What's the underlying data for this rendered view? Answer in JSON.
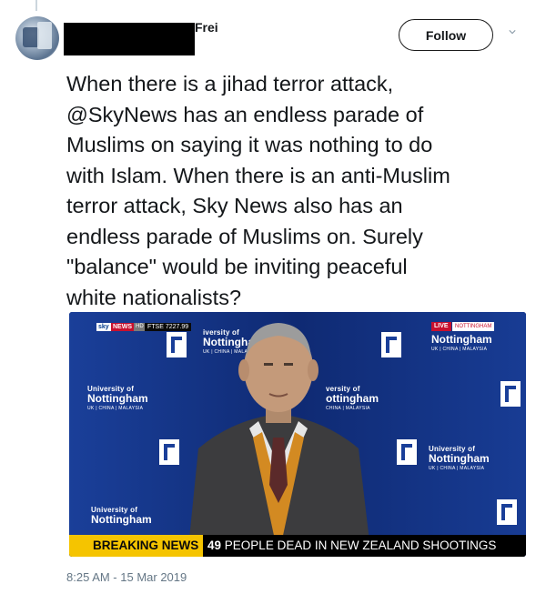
{
  "tweet": {
    "author_name": "Frei",
    "follow_label": "Follow",
    "text_lines": [
      "When there is a jihad terror attack,",
      "@SkyNews has an endless parade of",
      "Muslims on saying it was nothing to do",
      "with Islam. When there is an anti-Muslim",
      "terror attack, Sky News also has an",
      "endless parade of Muslims on. Surely",
      "\"balance\" would be inviting peaceful",
      "white nationalists?"
    ],
    "timestamp": "8:25 AM - 15 Mar 2019"
  },
  "media": {
    "channel_logo": "sky",
    "channel_name": "NEWS",
    "hd_badge": "HD",
    "ticker": "FTSE 7227.99",
    "live_badge": "LIVE",
    "live_location": "NOTTINGHAM",
    "backdrop": {
      "tile_univ": "University of",
      "tile_name": "Nottingham",
      "tile_sub": "UK | CHINA | MALAYSIA",
      "tile_univ_cut": "iversity of",
      "tile_name_cut": "Nottingha",
      "tile_sub_cut": "UK | CHINA | MALA",
      "tile_univ_cut2": "versity of",
      "tile_name_cut2": "ottingham",
      "tile_sub_cut2": "CHINA | MALAYSIA",
      "tile_sub_cut3": "UK | CHINA | MALAYSIA"
    },
    "breaking_label": "BREAKING NEWS",
    "headline_number": "49",
    "headline_text": "PEOPLE DEAD IN NEW ZEALAND SHOOTINGS"
  },
  "colors": {
    "backdrop_blue": "#1a3f99",
    "breaking_yellow": "#f5c400",
    "sky_red": "#c8102e",
    "timestamp_gray": "#657786"
  },
  "icons": {
    "dropdown": "chevron-down-icon"
  }
}
